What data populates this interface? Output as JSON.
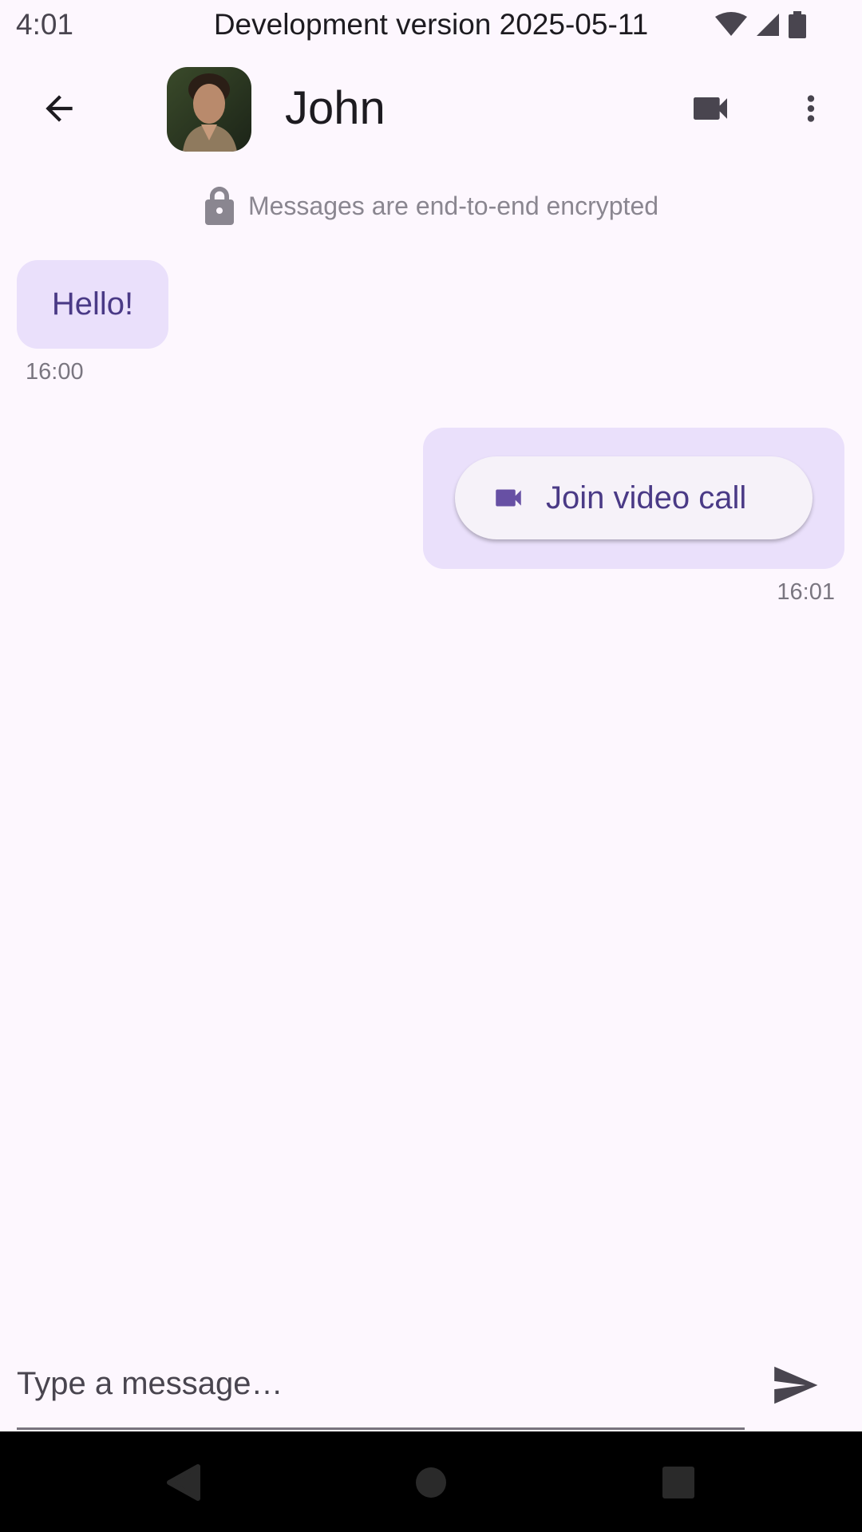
{
  "status_bar": {
    "time": "4:01",
    "center_text": "Development version 2025-05-11",
    "icons": [
      "wifi-icon",
      "signal-icon",
      "battery-icon"
    ]
  },
  "app_bar": {
    "contact_name": "John",
    "icons": [
      "arrow-back-icon",
      "videocam-icon",
      "more-vert-icon"
    ]
  },
  "encryption_notice": {
    "icon": "lock-icon",
    "text": "Messages are end-to-end encrypted"
  },
  "messages": [
    {
      "direction": "incoming",
      "text": "Hello!",
      "time": "16:00"
    },
    {
      "direction": "outgoing",
      "button_label": "Join video call",
      "button_icon": "videocam-icon",
      "time": "16:01"
    }
  ],
  "composer": {
    "placeholder": "Type a message…",
    "send_icon": "send-icon"
  },
  "nav_bar": {
    "icons": [
      "nav-back-icon",
      "nav-home-icon",
      "nav-recents-icon"
    ]
  },
  "colors": {
    "background": "#fdf7fe",
    "bubble": "#eae0fb",
    "accent": "#4a3a86",
    "video_icon": "#6750a4"
  }
}
